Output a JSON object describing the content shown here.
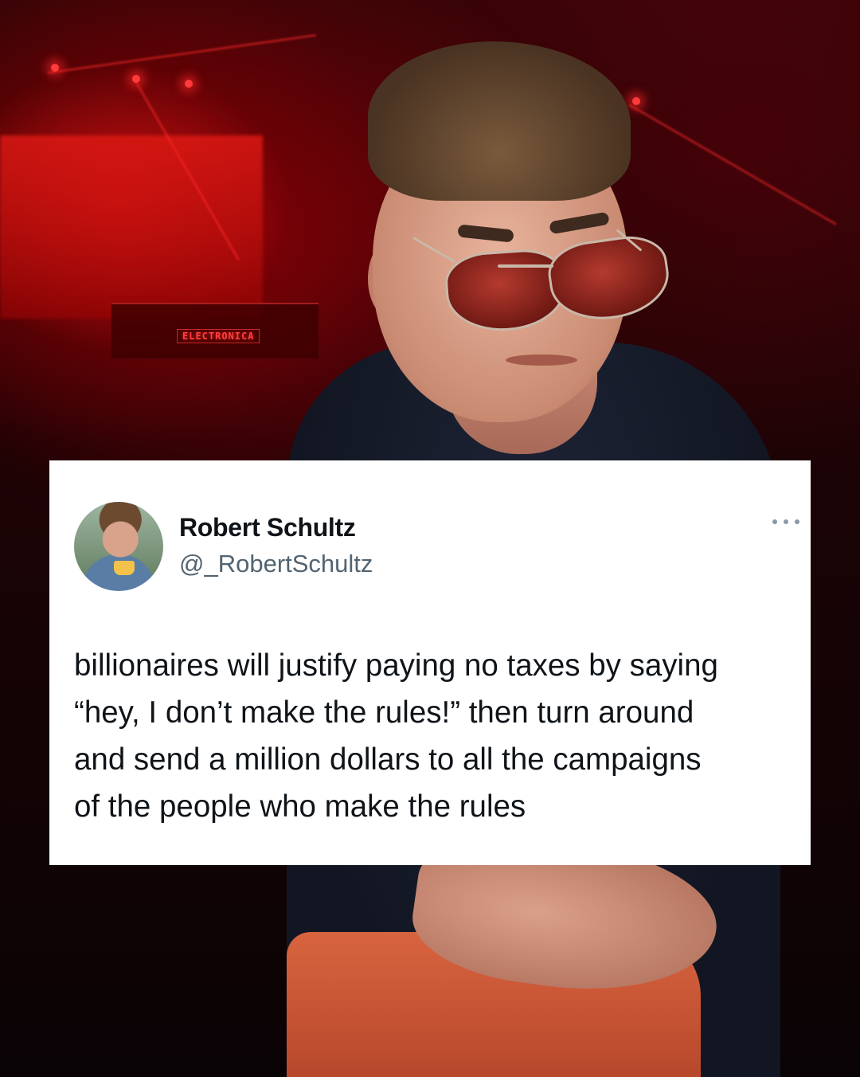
{
  "tweet": {
    "display_name": "Robert Schultz",
    "handle": "@_RobertSchultz",
    "text": "billionaires will justify paying no taxes by saying\n“hey, I don’t make the rules!” then turn around\nand send a million dollars to all the campaigns\nof the people who make the rules",
    "more_icon": "more-options-icon"
  },
  "background": {
    "sign_text": "ELECTRONICA"
  },
  "colors": {
    "card": "#ffffff",
    "name": "#0f1419",
    "handle": "#536471",
    "stage_red": "#e61414"
  }
}
